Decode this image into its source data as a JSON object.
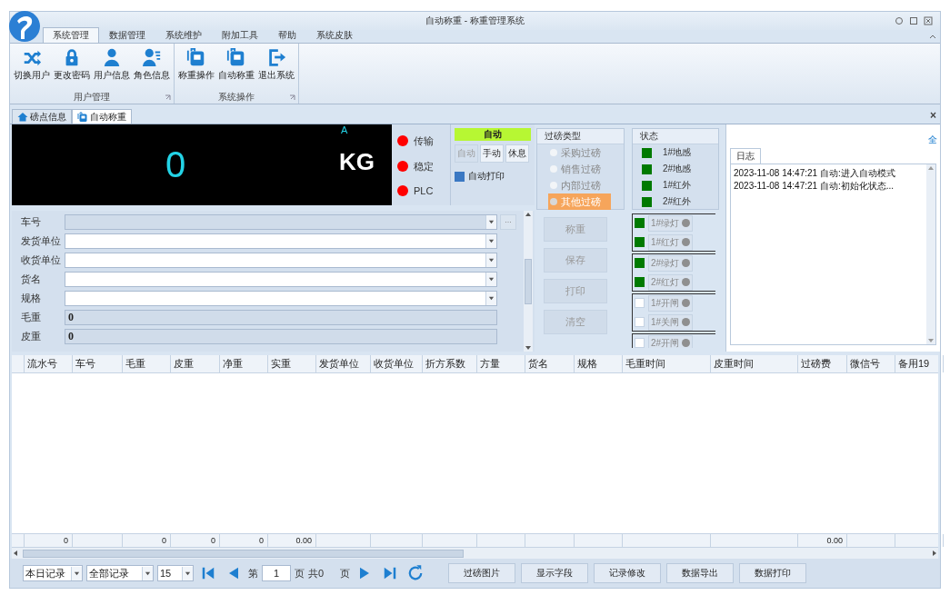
{
  "window": {
    "title": "自动称重 - 称重管理系统"
  },
  "ribbon_tabs": [
    {
      "label": "系统管理",
      "selected": true
    },
    {
      "label": "数据管理",
      "selected": false
    },
    {
      "label": "系统维护",
      "selected": false
    },
    {
      "label": "附加工具",
      "selected": false
    },
    {
      "label": "帮助",
      "selected": false
    },
    {
      "label": "系统皮肤",
      "selected": false
    }
  ],
  "ribbon_groups": [
    {
      "label": "用户管理",
      "buttons": [
        {
          "label": "切换用户",
          "kind": "shuffle"
        },
        {
          "label": "更改密码",
          "kind": "lock"
        },
        {
          "label": "用户信息",
          "kind": "user"
        },
        {
          "label": "角色信息",
          "kind": "userlist"
        }
      ]
    },
    {
      "label": "系统操作",
      "buttons": [
        {
          "label": "称重操作",
          "kind": "device"
        },
        {
          "label": "自动称重",
          "kind": "device"
        },
        {
          "label": "退出系统",
          "kind": "exit"
        }
      ]
    }
  ],
  "doc_tabs": [
    {
      "label": "磅点信息",
      "kind": "home",
      "selected": false
    },
    {
      "label": "自动称重",
      "kind": "device",
      "selected": true
    }
  ],
  "close_mark": "×",
  "scale": {
    "weight": "0",
    "channel": "A",
    "unit": "KG"
  },
  "indicators": [
    {
      "label": "传输",
      "color": "#ff0000"
    },
    {
      "label": "稳定",
      "color": "#ff0000"
    },
    {
      "label": "PLC",
      "color": "#ff0000"
    }
  ],
  "mode": {
    "status": "自动",
    "buttons": [
      {
        "label": "自动",
        "disabled": true
      },
      {
        "label": "手动",
        "disabled": false
      },
      {
        "label": "休息",
        "disabled": false
      }
    ],
    "auto_print": {
      "label": "自动打印",
      "checked": true
    }
  },
  "form": [
    {
      "label": "车号",
      "kind": "combo",
      "disabled": true,
      "more": "..."
    },
    {
      "label": "发货单位",
      "kind": "combo",
      "disabled": false
    },
    {
      "label": "收货单位",
      "kind": "combo",
      "disabled": false
    },
    {
      "label": "货名",
      "kind": "combo",
      "disabled": false
    },
    {
      "label": "规格",
      "kind": "combo",
      "disabled": false
    },
    {
      "label": "毛重",
      "kind": "readonly",
      "value": "0"
    },
    {
      "label": "皮重",
      "kind": "readonly",
      "value": "0"
    }
  ],
  "weigh_type": {
    "title": "过磅类型",
    "options": [
      {
        "label": "采购过磅",
        "selected": false
      },
      {
        "label": "销售过磅",
        "selected": false
      },
      {
        "label": "内部过磅",
        "selected": false
      },
      {
        "label": "其他过磅",
        "selected": true
      }
    ]
  },
  "status": {
    "title": "状态",
    "items": [
      {
        "label": "1#地感",
        "on": true
      },
      {
        "label": "2#地感",
        "on": true
      },
      {
        "label": "1#红外",
        "on": true
      },
      {
        "label": "2#红外",
        "on": true
      }
    ]
  },
  "actions": [
    {
      "label": "称重",
      "disabled": true
    },
    {
      "label": "保存",
      "disabled": true
    },
    {
      "label": "打印",
      "disabled": true
    },
    {
      "label": "清空",
      "disabled": true
    }
  ],
  "light_groups": [
    {
      "items": [
        {
          "label": "1#绿灯",
          "on": true
        },
        {
          "label": "1#红灯",
          "on": true
        }
      ]
    },
    {
      "items": [
        {
          "label": "2#绿灯",
          "on": true
        },
        {
          "label": "2#红灯",
          "on": true
        }
      ]
    },
    {
      "items": [
        {
          "label": "1#开闸",
          "on": false
        },
        {
          "label": "1#关闸",
          "on": false
        }
      ]
    },
    {
      "items": [
        {
          "label": "2#开闸",
          "on": false
        }
      ]
    }
  ],
  "log": {
    "corner": "全",
    "tab": "日志",
    "lines": [
      "2023-11-08 14:47:21 自动:进入自动模式",
      "2023-11-08 14:47:21 自动:初始化状态..."
    ]
  },
  "grid": {
    "columns": [
      {
        "label": "流水号",
        "total": "0"
      },
      {
        "label": "车号"
      },
      {
        "label": "毛重",
        "total": "0"
      },
      {
        "label": "皮重",
        "total": "0"
      },
      {
        "label": "净重",
        "total": "0"
      },
      {
        "label": "实重",
        "total": "0.00"
      },
      {
        "label": "发货单位"
      },
      {
        "label": "收货单位"
      },
      {
        "label": "折方系数"
      },
      {
        "label": "方量"
      },
      {
        "label": "货名"
      },
      {
        "label": "规格"
      },
      {
        "label": "毛重时间"
      },
      {
        "label": "皮重时间"
      },
      {
        "label": "过磅费",
        "total": "0.00"
      },
      {
        "label": "微信号"
      },
      {
        "label": "备用19"
      }
    ]
  },
  "pager": {
    "range": "本日记录",
    "filter": "全部记录",
    "page_size": "15",
    "page_prefix": "第",
    "page": "1",
    "page_suffix": "页",
    "total": "共0",
    "total_suffix": "页",
    "buttons": [
      "过磅图片",
      "显示字段",
      "记录修改",
      "数据导出",
      "数据打印"
    ]
  }
}
